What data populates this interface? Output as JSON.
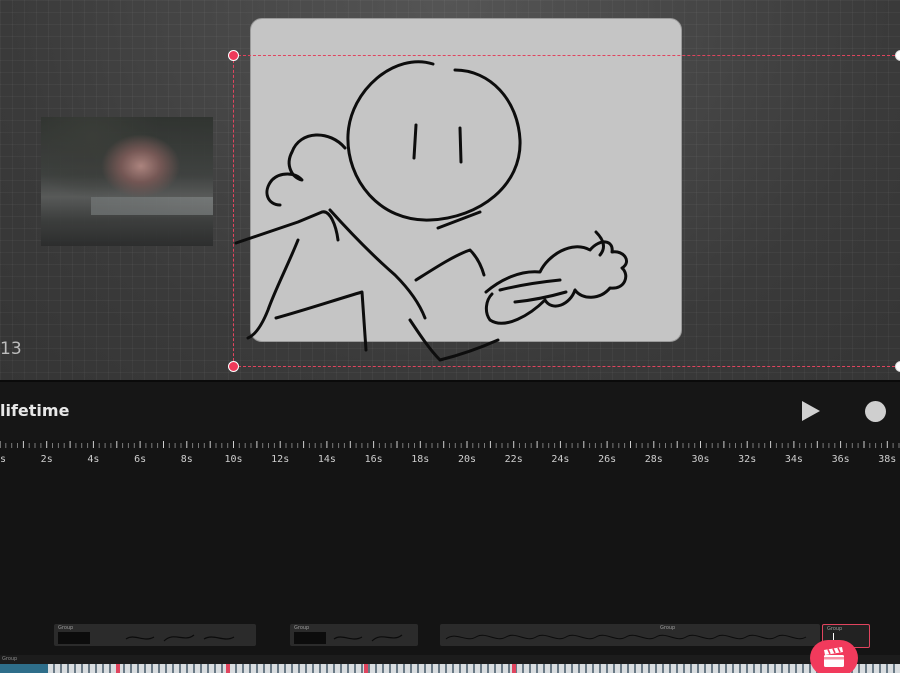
{
  "canvas": {
    "frame_counter": "13"
  },
  "timeline": {
    "title": "lifetime",
    "ruler_labels": [
      "s",
      "2s",
      "4s",
      "6s",
      "8s",
      "10s",
      "12s",
      "14s",
      "16s",
      "18s",
      "20s",
      "22s",
      "24s",
      "26s",
      "28s",
      "30s",
      "32s",
      "34s",
      "36s",
      "38s"
    ],
    "clips": [
      {
        "label": "Group"
      },
      {
        "label": "Group"
      },
      {
        "label": "Group"
      },
      {
        "label": "Group"
      }
    ],
    "bottom_track_label": "Group"
  },
  "colors": {
    "accent": "#f13a5c",
    "selection": "#e0445e",
    "canvas_bg": "#3d3d3d",
    "sketch_paper": "#c5c5c5",
    "timeline_bg": "#141414"
  },
  "icons": {
    "play": "play-icon",
    "record": "record-icon",
    "clapperboard": "clapperboard-icon"
  }
}
